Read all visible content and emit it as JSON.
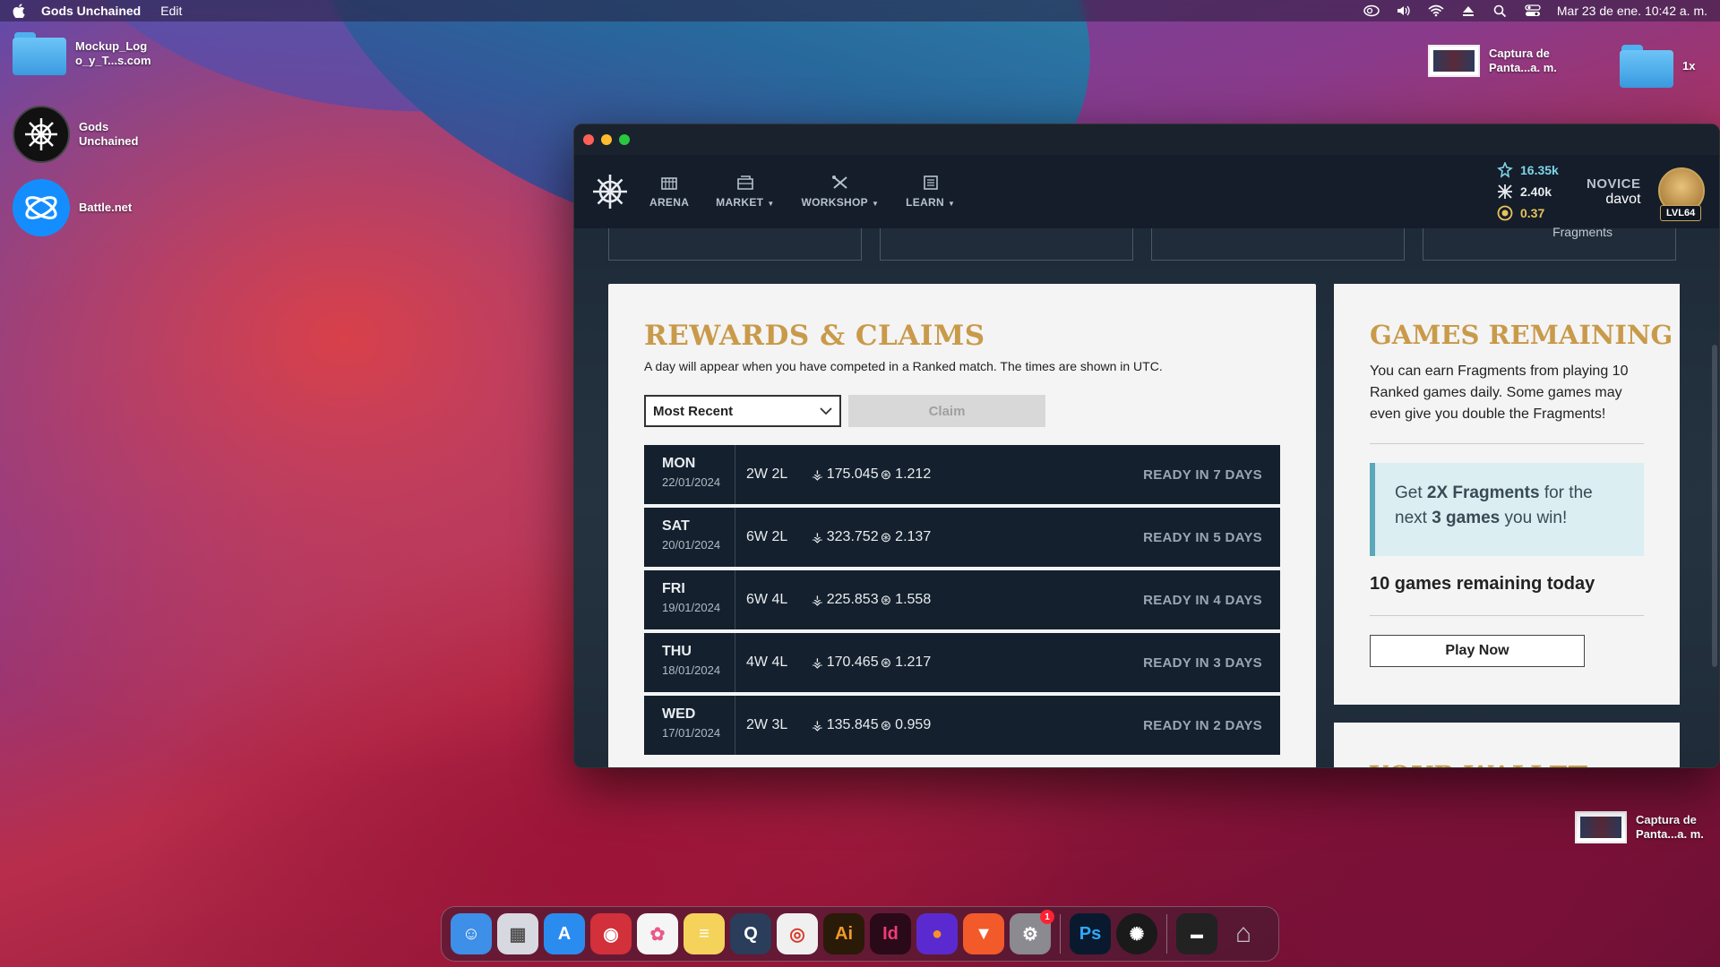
{
  "menubar": {
    "app_name": "Gods Unchained",
    "menus": [
      "Edit"
    ],
    "datetime": "Mar 23 de ene.  10:42 a. m."
  },
  "desktop": {
    "left_icons": [
      {
        "label": "Mockup_Log\no_y_T...s.com",
        "icon": "folder-icon"
      },
      {
        "label": "Gods\nUnchained",
        "icon": "gods-unchained-icon"
      },
      {
        "label": "Battle.net",
        "icon": "battlenet-icon"
      }
    ],
    "right_icons": [
      {
        "label": "Captura de\nPanta...a. m.",
        "icon": "screenshot-thumbnail"
      },
      {
        "label": "1x",
        "icon": "folder-icon"
      },
      {
        "label": "Captura de\nPanta...a. m.",
        "icon": "screenshot-thumbnail"
      }
    ]
  },
  "nav": {
    "items": [
      {
        "label": "ARENA",
        "icon": "arena-icon",
        "dropdown": false
      },
      {
        "label": "MARKET",
        "icon": "market-icon",
        "dropdown": true
      },
      {
        "label": "WORKSHOP",
        "icon": "workshop-icon",
        "dropdown": true
      },
      {
        "label": "LEARN",
        "icon": "learn-icon",
        "dropdown": true
      }
    ],
    "currencies": [
      {
        "value": "16.35k",
        "icon": "gods-token-icon",
        "color": "#7fd4e8"
      },
      {
        "value": "2.40k",
        "icon": "flux-icon",
        "color": "#e8ecf0"
      },
      {
        "value": "0.37",
        "icon": "gem-icon",
        "color": "#e8c25a"
      }
    ],
    "rank_title": "NOVICE",
    "username": "davot",
    "level": "LVL64"
  },
  "top_card_label": "Fragments",
  "rewards": {
    "title": "REWARDS & CLAIMS",
    "description": "A day will appear when you have competed in a Ranked match. The times are shown in UTC.",
    "sort_selected": "Most Recent",
    "claim_label": "Claim",
    "rows": [
      {
        "day": "MON",
        "date": "22/01/2024",
        "record": "2W 2L",
        "fragments": "175.045",
        "gods": "1.212",
        "status": "READY IN 7 DAYS"
      },
      {
        "day": "SAT",
        "date": "20/01/2024",
        "record": "6W 2L",
        "fragments": "323.752",
        "gods": "2.137",
        "status": "READY IN 5 DAYS"
      },
      {
        "day": "FRI",
        "date": "19/01/2024",
        "record": "6W 4L",
        "fragments": "225.853",
        "gods": "1.558",
        "status": "READY IN 4 DAYS"
      },
      {
        "day": "THU",
        "date": "18/01/2024",
        "record": "4W 4L",
        "fragments": "170.465",
        "gods": "1.217",
        "status": "READY IN 3 DAYS"
      },
      {
        "day": "WED",
        "date": "17/01/2024",
        "record": "2W 3L",
        "fragments": "135.845",
        "gods": "0.959",
        "status": "READY IN 2 DAYS"
      }
    ]
  },
  "games": {
    "title": "GAMES REMAINING",
    "description": "You can earn Fragments from playing 10 Ranked games daily. Some games may even give you double the Fragments!",
    "promo_prefix": "Get ",
    "promo_bold1": "2X Fragments",
    "promo_mid": " for the next ",
    "promo_bold2": "3 games",
    "promo_suffix": " you win!",
    "remaining": "10 games remaining today",
    "play_label": "Play Now"
  },
  "wallet_peek": "YOUR WALLET",
  "dock": {
    "apps": [
      {
        "name": "finder-icon",
        "color": "#3d8fe8",
        "glyph": "☺"
      },
      {
        "name": "launchpad-icon",
        "color": "#d8d8e0",
        "glyph": "▦"
      },
      {
        "name": "app-store-icon",
        "color": "#2b8cf0",
        "glyph": "A"
      },
      {
        "name": "photo-booth-icon",
        "color": "#d2303a",
        "glyph": "◉"
      },
      {
        "name": "photos-icon",
        "color": "#f5f5f5",
        "glyph": "✿"
      },
      {
        "name": "notes-icon",
        "color": "#f5d25a",
        "glyph": "≡"
      },
      {
        "name": "quicktime-icon",
        "color": "#2a3d5a",
        "glyph": "Q"
      },
      {
        "name": "chrome-icon",
        "color": "#f0f0f0",
        "glyph": "◎"
      },
      {
        "name": "illustrator-icon",
        "color": "#2a1a08",
        "glyph": "Ai"
      },
      {
        "name": "indesign-icon",
        "color": "#2a0a18",
        "glyph": "Id"
      },
      {
        "name": "firefox-icon",
        "color": "#5a2ad0",
        "glyph": "●"
      },
      {
        "name": "brave-icon",
        "color": "#f25a2a",
        "glyph": "▼"
      },
      {
        "name": "system-preferences-icon",
        "color": "#8a8a90",
        "glyph": "⚙",
        "badge": "1"
      }
    ],
    "apps2": [
      {
        "name": "photoshop-icon",
        "color": "#0a1a2e",
        "glyph": "Ps"
      },
      {
        "name": "gods-unchained-dock-icon",
        "color": "#1a1a1a",
        "glyph": "✺"
      }
    ],
    "apps3": [
      {
        "name": "recent-screenshot-icon",
        "color": "#222",
        "glyph": "▬"
      },
      {
        "name": "trash-icon",
        "color": "#c0c4c8",
        "glyph": "🗑"
      }
    ]
  }
}
